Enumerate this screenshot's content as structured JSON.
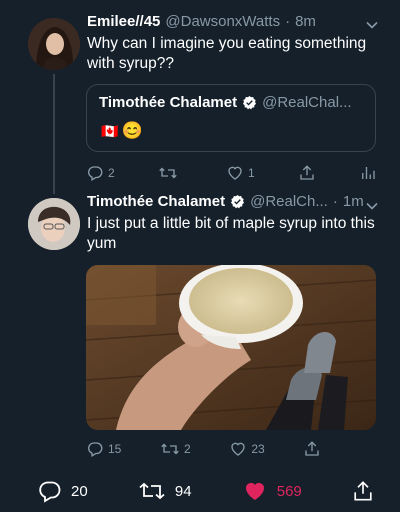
{
  "tweet1": {
    "display_name": "Emilee//45",
    "handle": "@DawsonxWatts",
    "separator": "·",
    "time": "8m",
    "text": "Why can I imagine you eating something with syrup??",
    "quote": {
      "display_name": "Timothée Chalamet",
      "handle": "@RealChal...",
      "emoji": [
        "🇨🇦",
        "😊"
      ]
    },
    "actions": {
      "replies": "2",
      "retweets": "",
      "likes": "1"
    }
  },
  "tweet2": {
    "display_name": "Timothée Chalamet",
    "handle": "@RealCh...",
    "separator": "·",
    "time": "1m",
    "text": "I just put a little bit of maple syrup into this yum",
    "actions": {
      "replies": "15",
      "retweets": "2",
      "likes": "23"
    }
  },
  "bottom_bar": {
    "replies": "20",
    "retweets": "94",
    "likes": "569"
  },
  "colors": {
    "background": "#15202b",
    "muted": "#8899a6",
    "border": "#38444d",
    "verified": "#ffffff",
    "like": "#e0245e"
  }
}
